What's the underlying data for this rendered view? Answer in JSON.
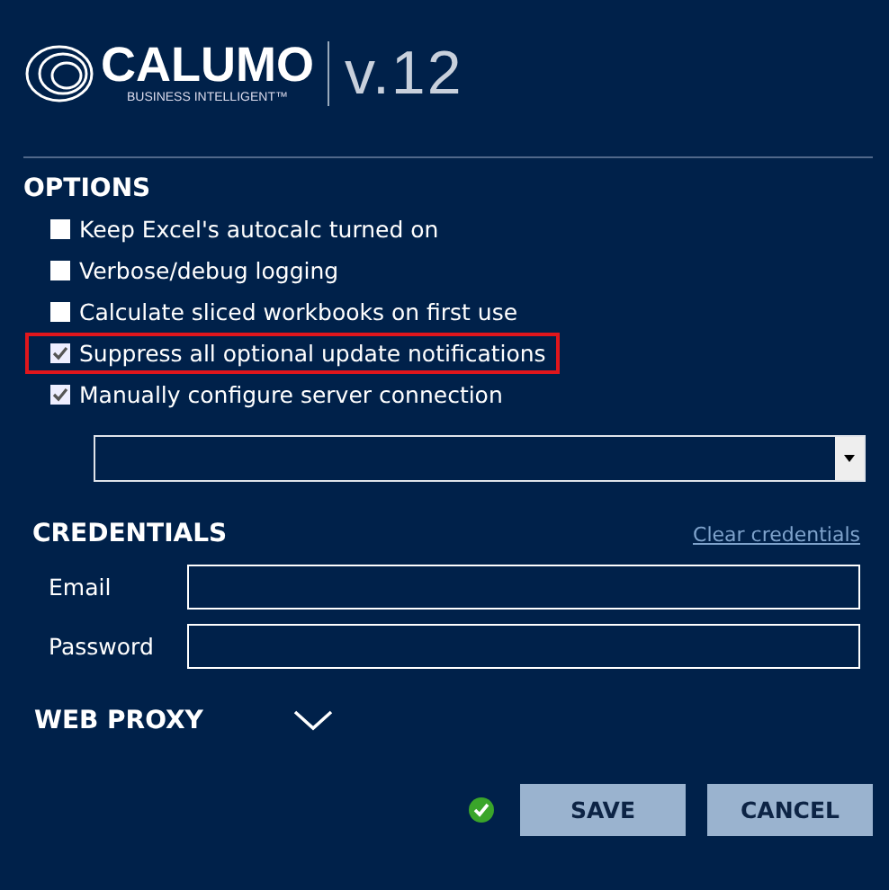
{
  "logo": {
    "name": "CALUMO",
    "tagline": "BUSINESS INTELLIGENT™",
    "version": "v.12"
  },
  "options": {
    "title": "OPTIONS",
    "items": [
      {
        "label": "Keep Excel's autocalc turned on",
        "checked": false,
        "highlighted": false
      },
      {
        "label": "Verbose/debug logging",
        "checked": false,
        "highlighted": false
      },
      {
        "label": "Calculate sliced workbooks on first use",
        "checked": false,
        "highlighted": false
      },
      {
        "label": "Suppress all optional update notifications",
        "checked": true,
        "highlighted": true
      },
      {
        "label": "Manually configure server connection",
        "checked": true,
        "highlighted": false
      }
    ]
  },
  "credentials": {
    "title": "CREDENTIALS",
    "clear_link": "Clear credentials",
    "fields": [
      {
        "label": "Email"
      },
      {
        "label": "Password"
      }
    ]
  },
  "web_proxy": {
    "title": "WEB PROXY",
    "expanded": false
  },
  "status": {
    "ok": true
  },
  "buttons": [
    "SAVE",
    "CANCEL"
  ]
}
